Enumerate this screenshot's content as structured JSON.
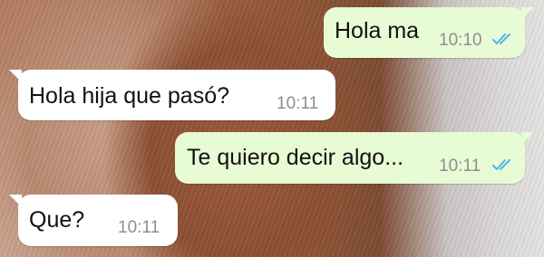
{
  "chat": {
    "messages": [
      {
        "direction": "outgoing",
        "text": "Hola ma",
        "time": "10:10",
        "status": "read"
      },
      {
        "direction": "incoming",
        "text": "Hola hija que pasó?",
        "time": "10:11"
      },
      {
        "direction": "outgoing",
        "text": "Te quiero decir algo...",
        "time": "10:11",
        "status": "read"
      },
      {
        "direction": "incoming",
        "text": "Que?",
        "time": "10:11"
      }
    ]
  },
  "colors": {
    "outgoing_bubble": "#e7fbd4",
    "incoming_bubble": "#ffffff",
    "read_ticks": "#4fb6ec",
    "timestamp": "#8b8f93"
  },
  "icons": {
    "read_receipt": "double-check-icon"
  }
}
